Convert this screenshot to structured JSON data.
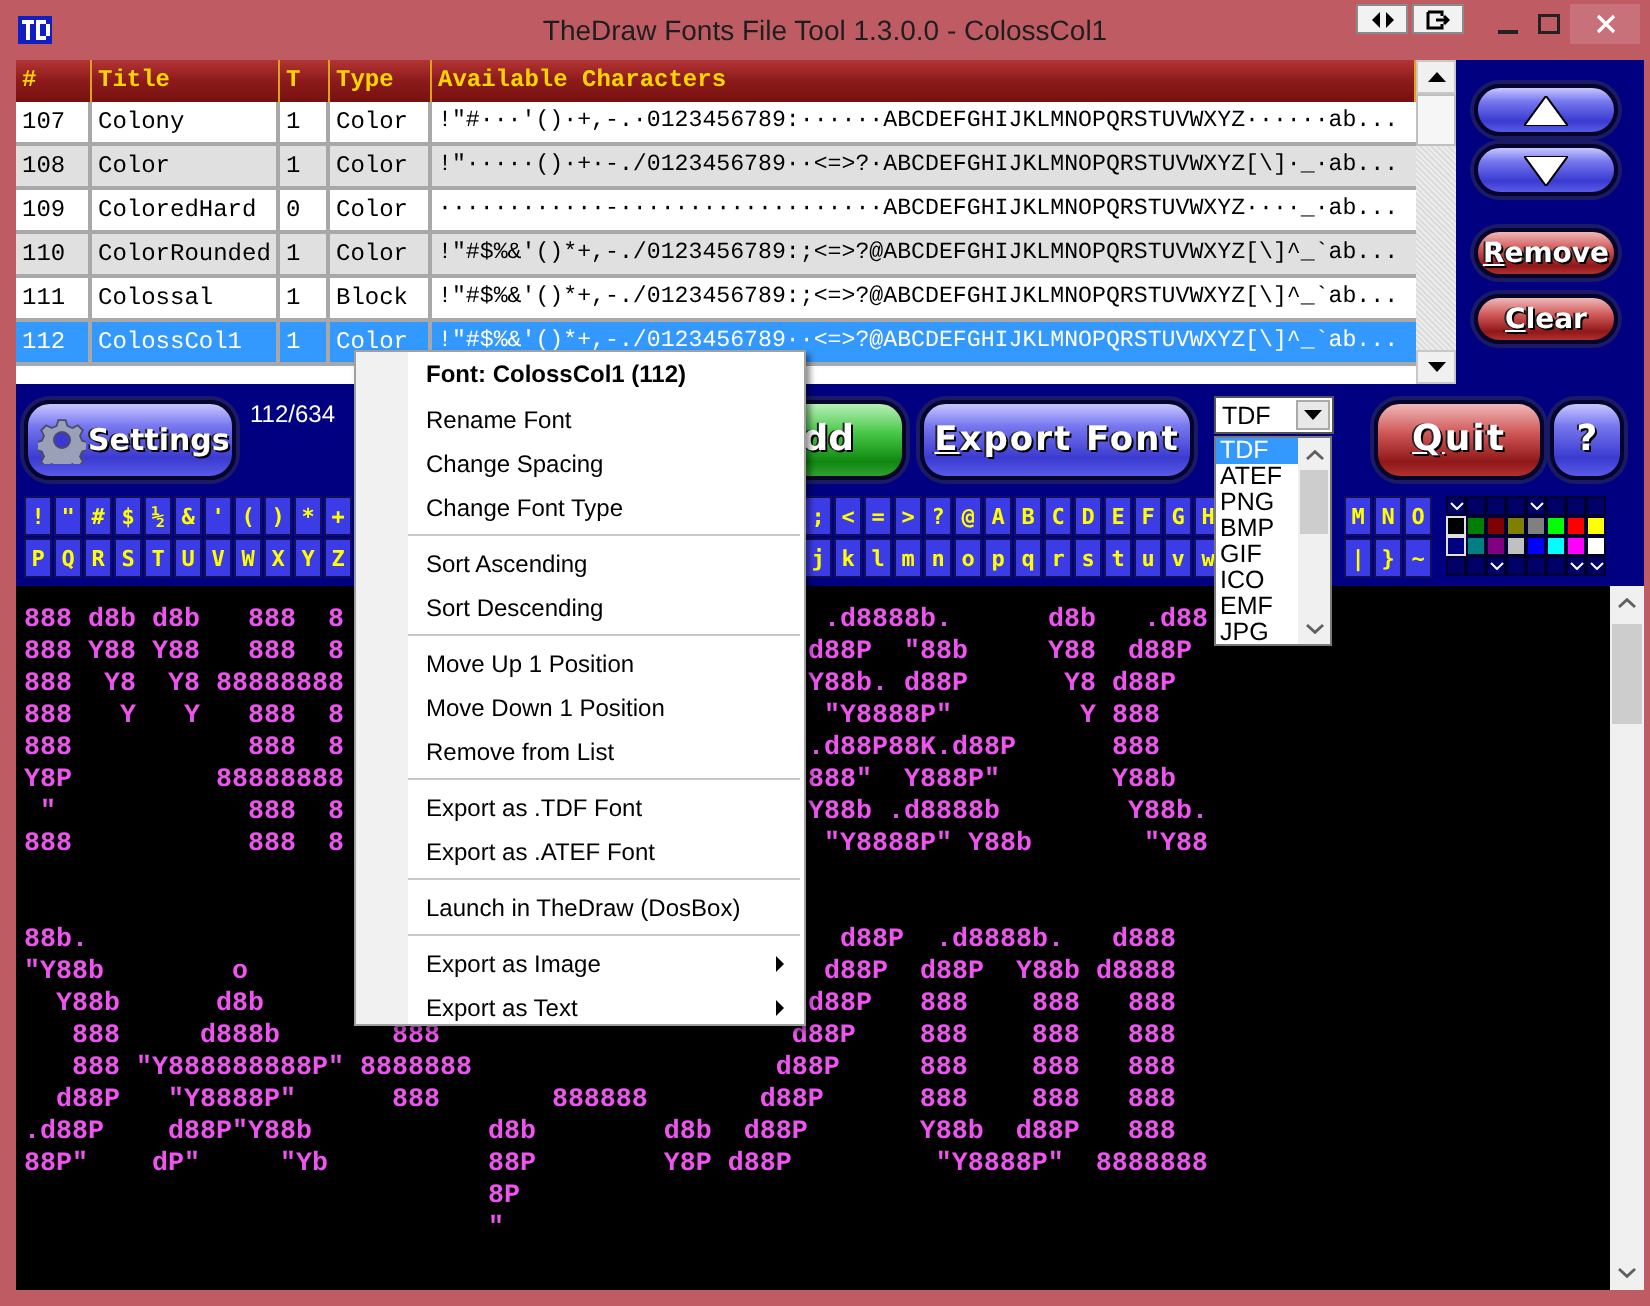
{
  "window": {
    "title": "TheDraw Fonts File Tool 1.3.0.0 - ColossCol1"
  },
  "table": {
    "columns": [
      "#",
      "Title",
      "T",
      "Type",
      "Available Characters"
    ],
    "rows": [
      {
        "cells": [
          "107",
          "Colony",
          "1",
          "Color",
          "!\"#···'()·+,-.·0123456789:······ABCDEFGHIJKLMNOPQRSTUVWXYZ······ab..."
        ],
        "selected": false
      },
      {
        "cells": [
          "108",
          "Color",
          "1",
          "Color",
          "!\"·····()·+·-./0123456789··<=>?·ABCDEFGHIJKLMNOPQRSTUVWXYZ[\\]·_·ab..."
        ],
        "selected": false
      },
      {
        "cells": [
          "109",
          "ColoredHard",
          "0",
          "Color",
          "············-···················ABCDEFGHIJKLMNOPQRSTUVWXYZ····_·ab..."
        ],
        "selected": false
      },
      {
        "cells": [
          "110",
          "ColorRounded",
          "1",
          "Color",
          "!\"#$%&'()*+,-./0123456789:;<=>?@ABCDEFGHIJKLMNOPQRSTUVWXYZ[\\]^_`ab..."
        ],
        "selected": false
      },
      {
        "cells": [
          "111",
          "Colossal",
          "1",
          "Block",
          "!\"#$%&'()*+,-./0123456789:;<=>?@ABCDEFGHIJKLMNOPQRSTUVWXYZ[\\]^_`ab..."
        ],
        "selected": false
      },
      {
        "cells": [
          "112",
          "ColossCol1",
          "1",
          "Color",
          "!\"#$%&'()*+,-./0123456789··<=>?@ABCDEFGHIJKLMNOPQRSTUVWXYZ[\\]^_`ab..."
        ],
        "selected": true
      }
    ]
  },
  "side_buttons": [
    {
      "kind": "up"
    },
    {
      "kind": "down"
    },
    {
      "kind": "text",
      "label": "Remove"
    },
    {
      "kind": "text",
      "label": "Clear"
    }
  ],
  "toolbar": {
    "settings": "Settings",
    "counter": "112/634",
    "add": "dd",
    "export": "Export Font",
    "format": {
      "value": "TDF",
      "options": [
        {
          "label": "TDF",
          "selected": true
        },
        {
          "label": "ATEF",
          "selected": false
        },
        {
          "label": "PNG",
          "selected": false
        },
        {
          "label": "BMP",
          "selected": false
        },
        {
          "label": "GIF",
          "selected": false
        },
        {
          "label": "ICO",
          "selected": false
        },
        {
          "label": "EMF",
          "selected": false
        },
        {
          "label": "JPG",
          "selected": false
        }
      ]
    },
    "quit": "Quit",
    "help": "?"
  },
  "character_keys": [
    {
      "groups": [
        [
          "!",
          "\"",
          "#",
          "$",
          "½",
          "&",
          "'",
          "(",
          ")",
          "*",
          "+"
        ],
        [
          ";",
          "<",
          "=",
          ">",
          "?",
          "@",
          "A",
          "B",
          "C",
          "D",
          "E",
          "F",
          "G",
          "H"
        ],
        [
          "M",
          "N",
          "O"
        ]
      ]
    },
    {
      "groups": [
        [
          "P",
          "Q",
          "R",
          "S",
          "T",
          "U",
          "V",
          "W",
          "X",
          "Y",
          "Z"
        ],
        [
          "j",
          "k",
          "l",
          "m",
          "n",
          "o",
          "p",
          "q",
          "r",
          "s",
          "t",
          "u",
          "v",
          "w"
        ],
        [
          "|",
          "}",
          "~"
        ]
      ]
    }
  ],
  "palette": {
    "top_marks": [
      {
        "on": true
      },
      {
        "on": false
      },
      {
        "on": false
      },
      {
        "on": false
      },
      {
        "on": true
      },
      {
        "on": false
      },
      {
        "on": false
      },
      {
        "on": false
      }
    ],
    "swatches": [
      {
        "color": "#000000",
        "selected": true
      },
      {
        "color": "#008000",
        "selected": false
      },
      {
        "color": "#800000",
        "selected": false
      },
      {
        "color": "#808000",
        "selected": false
      },
      {
        "color": "#808080",
        "selected": false
      },
      {
        "color": "#00ff00",
        "selected": false
      },
      {
        "color": "#ff0000",
        "selected": false
      },
      {
        "color": "#ffff00",
        "selected": false
      },
      {
        "color": "#000080",
        "selected": true
      },
      {
        "color": "#008080",
        "selected": false
      },
      {
        "color": "#800080",
        "selected": false
      },
      {
        "color": "#c0c0c0",
        "selected": false
      },
      {
        "color": "#0000ff",
        "selected": false
      },
      {
        "color": "#00ffff",
        "selected": false
      },
      {
        "color": "#ff00ff",
        "selected": false
      },
      {
        "color": "#ffffff",
        "selected": false
      }
    ],
    "bottom_marks": [
      {
        "on": false
      },
      {
        "on": false
      },
      {
        "on": true
      },
      {
        "on": false
      },
      {
        "on": false
      },
      {
        "on": false
      },
      {
        "on": true
      },
      {
        "on": true
      }
    ]
  },
  "preview": {
    "blocks": [
      {
        "lines": [
          {
            "kind": "split",
            "left": "888 d8b d8b   888  8",
            "right": " .d8888b.      d8b   .d88"
          },
          {
            "kind": "split",
            "left": "888 Y88 Y88   888  8",
            "right": "d88P  \"88b     Y88  d88P"
          },
          {
            "kind": "split",
            "left": "888  Y8  Y8 88888888",
            "right": "Y88b. d88P      Y8 d88P"
          },
          {
            "kind": "split",
            "left": "888   Y   Y   888  8",
            "right": " \"Y8888P\"        Y 888"
          },
          {
            "kind": "split",
            "left": "888           888  8",
            "right": ".d88P88K.d88P      888"
          },
          {
            "kind": "split",
            "left": "Y8P         88888888",
            "right": "888\"  Y888P\"       Y88b"
          },
          {
            "kind": "split",
            "left": " \"            888  8",
            "right": "Y88b .d8888b        Y88b."
          },
          {
            "kind": "split",
            "left": "888           888  8",
            "right": " \"Y8888P\" Y88b       \"Y88"
          }
        ]
      },
      {
        "lines": [
          {
            "kind": "split",
            "left": "88b.",
            "right": "  d88P  .d8888b.   d888"
          },
          {
            "kind": "split",
            "left": "\"Y88b        o",
            "right": " d88P  d88P  Y88b d8888"
          },
          {
            "kind": "split",
            "left": "  Y88b      d8b",
            "right": "d88P   888    888   888"
          },
          {
            "kind": "full",
            "text": "   888     d888b       888                      d88P    888    888   888"
          },
          {
            "kind": "full",
            "text": "   888 \"Y888888888P\" 8888888                   d88P     888    888   888"
          },
          {
            "kind": "full",
            "text": "  d88P   \"Y8888P\"      888       888888       d88P      888    888   888"
          },
          {
            "kind": "full",
            "text": ".d88P    d88P\"Y88b           d8b        d8b  d88P       Y88b  d88P   888"
          },
          {
            "kind": "full",
            "text": "88P\"    dP\"     \"Yb          88P        Y8P d88P         \"Y8888P\"  8888888"
          },
          {
            "kind": "full",
            "text": "                             8P"
          },
          {
            "kind": "full",
            "text": "                             \""
          }
        ]
      }
    ]
  },
  "context_menu": {
    "title": "Font: ColossCol1 (112)",
    "groups": [
      [
        {
          "label": "Rename Font",
          "submenu": false
        },
        {
          "label": "Change Spacing",
          "submenu": false
        },
        {
          "label": "Change Font Type",
          "submenu": false
        }
      ],
      [
        {
          "label": "Sort Ascending",
          "submenu": false
        },
        {
          "label": "Sort Descending",
          "submenu": false
        }
      ],
      [
        {
          "label": "Move Up 1 Position",
          "submenu": false
        },
        {
          "label": "Move Down 1 Position",
          "submenu": false
        },
        {
          "label": "Remove from List",
          "submenu": false
        }
      ],
      [
        {
          "label": "Export as .TDF Font",
          "submenu": false
        },
        {
          "label": "Export as .ATEF Font",
          "submenu": false
        }
      ],
      [
        {
          "label": "Launch in TheDraw (DosBox)",
          "submenu": false
        }
      ],
      [
        {
          "label": "Export as Image",
          "submenu": true
        },
        {
          "label": "Export as Text",
          "submenu": true
        }
      ]
    ]
  }
}
